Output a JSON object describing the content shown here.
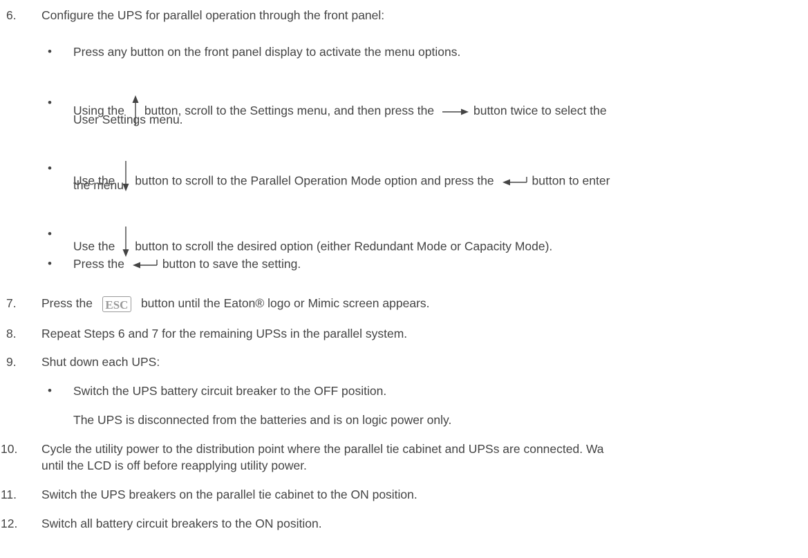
{
  "steps": [
    {
      "num": "6.",
      "text": "Configure the UPS for parallel operation through the front panel:"
    },
    {
      "num": "7.",
      "pre": "Press the",
      "button": "ESC",
      "post": "button until the Eaton® logo or Mimic screen appears."
    },
    {
      "num": "8.",
      "text": "Repeat Steps 6 and 7 for the remaining UPSs in the parallel system."
    },
    {
      "num": "9.",
      "text": "Shut down each UPS:"
    },
    {
      "num": "10.",
      "text1": "Cycle the utility power to the distribution point where the parallel tie cabinet and UPSs are connected. Wa",
      "text2": "until the LCD is off before reapplying utility power."
    },
    {
      "num": "11.",
      "text": "Switch the UPS breakers on the parallel tie cabinet to the ON position."
    },
    {
      "num": "12.",
      "text": "Switch all battery circuit breakers to the ON position."
    }
  ],
  "sub6": [
    {
      "text": "Press any button on the front panel display to activate the menu options."
    },
    {
      "a": "Using the",
      "icon1": "up-arrow-icon",
      "b": "button, scroll to the Settings menu, and then press the",
      "icon2": "right-arrow-icon",
      "c": "button twice to select the",
      "line2": "User Settings menu."
    },
    {
      "a": "Use the",
      "icon1": "down-arrow-icon",
      "b": "button to scroll to the Parallel Operation Mode option and press the",
      "icon2": "enter-icon",
      "c": "button to enter",
      "line2": "the menu."
    },
    {
      "a": "Use the",
      "icon1": "down-arrow-icon",
      "b": "button to scroll the desired option (either Redundant Mode or Capacity Mode)."
    },
    {
      "a": "Press the",
      "icon1": "enter-icon",
      "b": "button to save the setting."
    }
  ],
  "sub9": [
    {
      "text": "Switch the UPS battery circuit breaker to the OFF position.",
      "note": "The UPS is disconnected from the batteries and is on logic power only."
    }
  ],
  "bullet_char": "•"
}
